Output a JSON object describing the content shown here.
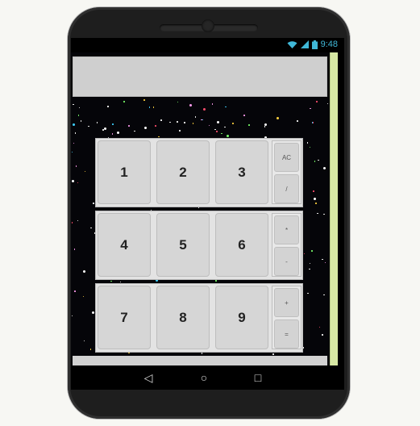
{
  "status": {
    "time": "9:48"
  },
  "display": {
    "value": ""
  },
  "keypad": {
    "rows": [
      {
        "numbers": [
          "1",
          "2",
          "3"
        ],
        "ops": [
          "AC",
          "/"
        ]
      },
      {
        "numbers": [
          "4",
          "5",
          "6"
        ],
        "ops": [
          "*",
          "-"
        ]
      },
      {
        "numbers": [
          "7",
          "8",
          "9"
        ],
        "ops": [
          "+",
          "="
        ]
      }
    ]
  },
  "navbar": {
    "back": "◁",
    "home": "○",
    "recents": "□"
  },
  "colors": {
    "display_bg": "#cfcfcf",
    "key_bg": "#d6d6d6",
    "sidebar": "#d7e8a4",
    "status_icon": "#40b8d8"
  }
}
